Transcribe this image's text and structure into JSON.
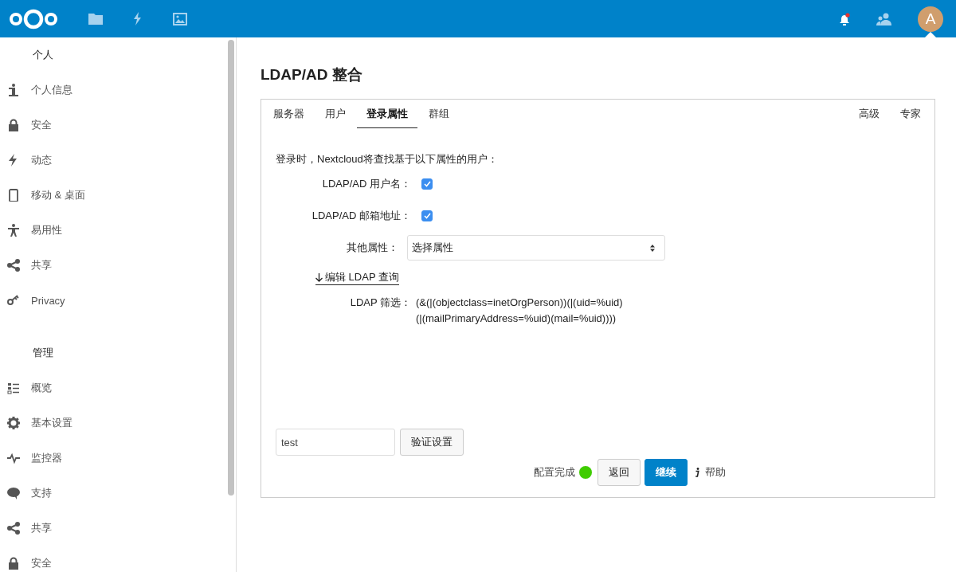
{
  "header": {
    "avatar": {
      "letter": "A"
    },
    "notifications": {
      "unread": true
    }
  },
  "sidebar": {
    "sections": [
      {
        "heading": "个人",
        "items": [
          {
            "label": "个人信息",
            "selected": false
          },
          {
            "label": "安全",
            "selected": false
          },
          {
            "label": "动态",
            "selected": false
          },
          {
            "label": "移动 & 桌面",
            "selected": false
          },
          {
            "label": "易用性",
            "selected": false
          },
          {
            "label": "共享",
            "selected": false
          },
          {
            "label": "Privacy",
            "selected": false
          }
        ]
      },
      {
        "heading": "管理",
        "items": [
          {
            "label": "概览",
            "selected": false
          },
          {
            "label": "基本设置",
            "selected": false
          },
          {
            "label": "监控器",
            "selected": false
          },
          {
            "label": "支持",
            "selected": false
          },
          {
            "label": "共享",
            "selected": false
          },
          {
            "label": "安全",
            "selected": false
          }
        ]
      }
    ]
  },
  "page": {
    "title": "LDAP/AD 整合",
    "tabs": [
      {
        "label": "服务器",
        "selected": false
      },
      {
        "label": "用户",
        "selected": false
      },
      {
        "label": "登录属性",
        "selected": true
      },
      {
        "label": "群组",
        "selected": false
      }
    ],
    "right_tabs": [
      {
        "label": "高级",
        "selected": false
      },
      {
        "label": "专家",
        "selected": false
      }
    ],
    "intro": "登录时，Nextcloud将查找基于以下属性的用户：",
    "options": [
      {
        "label": "LDAP/AD 用户名：",
        "checked": true
      },
      {
        "label": "LDAP/AD 邮箱地址：",
        "checked": true
      }
    ],
    "other_attributes": {
      "label": "其他属性：",
      "value": "选择属性"
    },
    "edit_query_link": "编辑 LDAP 查询",
    "filter": {
      "label": "LDAP 筛选：",
      "value": "(&(|(objectclass=inetOrgPerson))(|(uid=%uid)(|(mailPrimaryAddress=%uid)(mail=%uid))))"
    },
    "test_field": {
      "value": "test"
    },
    "verify_button": "验证设置",
    "status": {
      "label": "配置完成",
      "ok": true
    },
    "back_button": "返回",
    "continue_button": "继续",
    "help_link": "帮助"
  }
}
